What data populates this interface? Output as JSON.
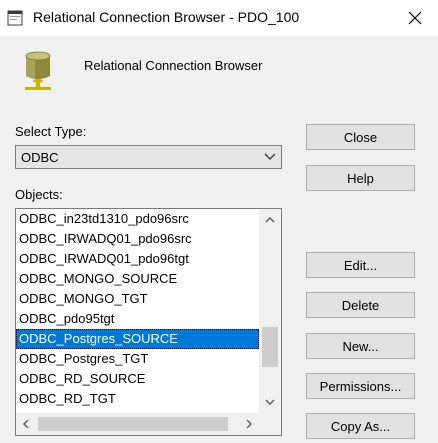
{
  "window": {
    "title": "Relational Connection Browser - PDO_100",
    "close_glyph": "✕"
  },
  "header": {
    "text": "Relational Connection Browser",
    "icon": "database-icon"
  },
  "type_select": {
    "label": "Select Type:",
    "value": "ODBC"
  },
  "objects": {
    "label": "Objects:",
    "items": [
      "ODBC_in23td1310_pdo96src",
      "ODBC_IRWADQ01_pdo96src",
      "ODBC_IRWADQ01_pdo96tgt",
      "ODBC_MONGO_SOURCE",
      "ODBC_MONGO_TGT",
      "ODBC_pdo95tgt",
      "ODBC_Postgres_SOURCE",
      "ODBC_Postgres_TGT",
      "ODBC_RD_SOURCE",
      "ODBC_RD_TGT"
    ],
    "selected_index": 6,
    "vertical_scroll": {
      "thumb_start": 0.6,
      "thumb_length": 0.25
    }
  },
  "buttons": {
    "close": "Close",
    "help": "Help",
    "edit": "Edit...",
    "delete": "Delete",
    "new": "New...",
    "permissions": "Permissions...",
    "copy_as": "Copy As..."
  },
  "colors": {
    "selection": "#0078d7",
    "window_bg": "#f0f0f0",
    "button_bg": "#e1e1e1"
  }
}
